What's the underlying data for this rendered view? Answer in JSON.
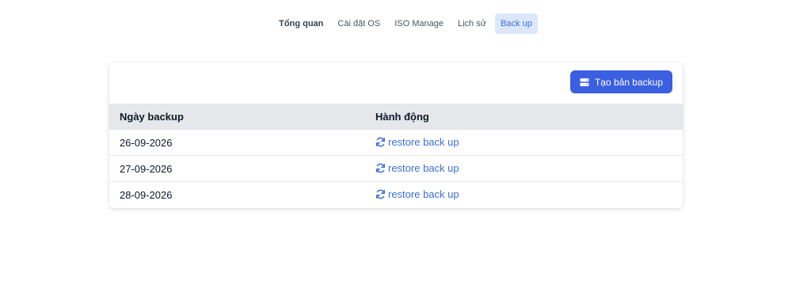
{
  "tabs": [
    {
      "label": "Tổng quan"
    },
    {
      "label": "Cài đặt OS"
    },
    {
      "label": "ISO Manage"
    },
    {
      "label": "Lịch sử"
    },
    {
      "label": "Back up"
    }
  ],
  "toolbar": {
    "create_backup_label": "Tạo bản backup",
    "create_backup_icon": "server-icon"
  },
  "table": {
    "headers": [
      "Ngày backup",
      "Hành động"
    ],
    "rows": [
      {
        "date": "26-09-2026",
        "action": "restore back up"
      },
      {
        "date": "27-09-2026",
        "action": "restore back up"
      },
      {
        "date": "28-09-2026",
        "action": "restore back up"
      }
    ],
    "action_icon": "refresh-icon"
  },
  "colors": {
    "accent": "#3b5fe0",
    "link": "#3b6fd8",
    "active_tab_bg": "#dbe7fb",
    "header_bg": "#e5e7eb"
  }
}
